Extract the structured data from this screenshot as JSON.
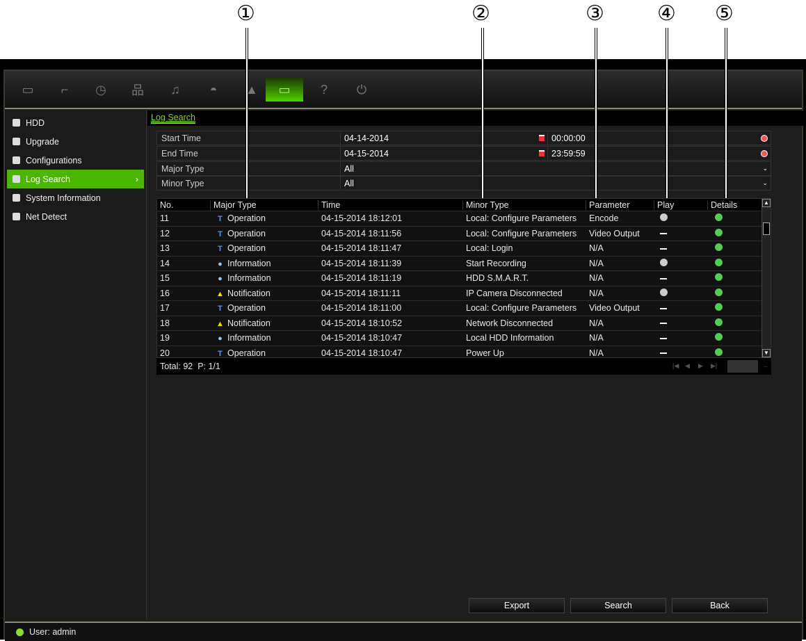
{
  "callouts": [
    "①",
    "②",
    "③",
    "④",
    "⑤"
  ],
  "toolbar": {
    "icons": [
      "monitor-icon",
      "camera-icon",
      "clock-icon",
      "network-icon",
      "bell-icon",
      "dome-camera-icon",
      "user-icon",
      "hdd-icon",
      "help-icon",
      "power-icon"
    ],
    "active": "hdd-icon"
  },
  "sidebar": {
    "items": [
      {
        "label": "HDD",
        "icon": "hdd-icon"
      },
      {
        "label": "Upgrade",
        "icon": "upgrade-icon"
      },
      {
        "label": "Configurations",
        "icon": "config-icon"
      },
      {
        "label": "Log Search",
        "icon": "log-icon",
        "active": true
      },
      {
        "label": "System Information",
        "icon": "info-icon"
      },
      {
        "label": "Net Detect",
        "icon": "net-icon"
      }
    ]
  },
  "tab": "Log Search",
  "form": {
    "start_time": {
      "label": "Start Time",
      "date": "04-14-2014",
      "time": "00:00:00"
    },
    "end_time": {
      "label": "End Time",
      "date": "04-15-2014",
      "time": "23:59:59"
    },
    "major_type": {
      "label": "Major Type",
      "value": "All"
    },
    "minor_type": {
      "label": "Minor Type",
      "value": "All"
    }
  },
  "table": {
    "columns": [
      "No.",
      "Major Type",
      "Time",
      "Minor Type",
      "Parameter",
      "Play",
      "Details"
    ],
    "rows": [
      {
        "no": "11",
        "major": "Operation",
        "time": "04-15-2014 18:12:01",
        "minor": "Local: Configure Parameters",
        "param": "Encode",
        "play": true
      },
      {
        "no": "12",
        "major": "Operation",
        "time": "04-15-2014 18:11:56",
        "minor": "Local: Configure Parameters",
        "param": "Video Output",
        "play": false
      },
      {
        "no": "13",
        "major": "Operation",
        "time": "04-15-2014 18:11:47",
        "minor": "Local: Login",
        "param": "N/A",
        "play": false
      },
      {
        "no": "14",
        "major": "Information",
        "time": "04-15-2014 18:11:39",
        "minor": "Start Recording",
        "param": "N/A",
        "play": true
      },
      {
        "no": "15",
        "major": "Information",
        "time": "04-15-2014 18:11:19",
        "minor": "HDD S.M.A.R.T.",
        "param": "N/A",
        "play": false
      },
      {
        "no": "16",
        "major": "Notification",
        "time": "04-15-2014 18:11:11",
        "minor": "IP Camera Disconnected",
        "param": "N/A",
        "play": true
      },
      {
        "no": "17",
        "major": "Operation",
        "time": "04-15-2014 18:11:00",
        "minor": "Local: Configure Parameters",
        "param": "Video Output",
        "play": false
      },
      {
        "no": "18",
        "major": "Notification",
        "time": "04-15-2014 18:10:52",
        "minor": "Network Disconnected",
        "param": "N/A",
        "play": false
      },
      {
        "no": "19",
        "major": "Information",
        "time": "04-15-2014 18:10:47",
        "minor": "Local HDD Information",
        "param": "N/A",
        "play": false
      },
      {
        "no": "20",
        "major": "Operation",
        "time": "04-15-2014 18:10:47",
        "minor": "Power Up",
        "param": "N/A",
        "play": false
      }
    ],
    "footer": "Total: 92  P: 1/1"
  },
  "buttons": {
    "export": "Export",
    "search": "Search",
    "back": "Back"
  },
  "status": "User: admin",
  "colors": {
    "accent": "#4ab600",
    "operation": "#4a9cff",
    "information": "#8cc8ff",
    "notification": "#ffd800"
  }
}
